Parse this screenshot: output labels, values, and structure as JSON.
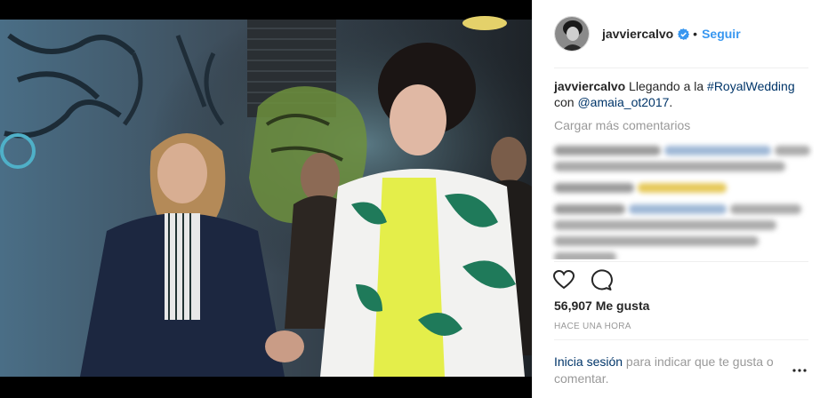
{
  "post": {
    "username": "javviercalvo",
    "verified_icon": "verified-badge-icon",
    "dot": "•",
    "follow_label": "Seguir",
    "caption": {
      "username": "javviercalvo",
      "text_before": " Llegando a la ",
      "hashtag": "#RoyalWedding",
      "text_mid": " con ",
      "mention": "@amaia_ot2017",
      "text_after": "."
    },
    "load_more_comments": "Cargar más comentarios",
    "likes": "56,907 Me gusta",
    "timestamp": "HACE UNA HORA",
    "login_prompt": {
      "link": "Inicia sesión",
      "text": " para indicar que te gusta o comentar."
    }
  },
  "icons": {
    "like": "heart-outline-icon",
    "comment": "comment-bubble-icon",
    "more": "more-options-icon"
  },
  "colors": {
    "link": "#003569",
    "follow": "#3897f0",
    "muted": "#999999"
  }
}
